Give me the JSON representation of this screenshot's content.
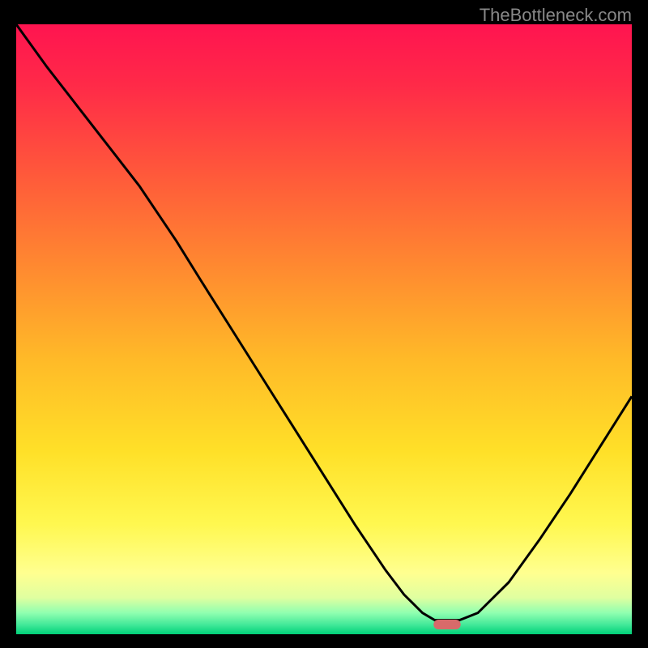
{
  "watermark": "TheBottleneck.com",
  "chart_data": {
    "type": "line",
    "title": "",
    "xlabel": "",
    "ylabel": "",
    "xlim": [
      0,
      100
    ],
    "ylim": [
      0,
      100
    ],
    "background_gradient": {
      "stops": [
        {
          "offset": 0.0,
          "color": "#ff1450"
        },
        {
          "offset": 0.1,
          "color": "#ff2a48"
        },
        {
          "offset": 0.25,
          "color": "#ff5a3a"
        },
        {
          "offset": 0.4,
          "color": "#ff8a30"
        },
        {
          "offset": 0.55,
          "color": "#ffba28"
        },
        {
          "offset": 0.7,
          "color": "#ffe028"
        },
        {
          "offset": 0.82,
          "color": "#fff850"
        },
        {
          "offset": 0.9,
          "color": "#ffff90"
        },
        {
          "offset": 0.94,
          "color": "#e0ffa0"
        },
        {
          "offset": 0.965,
          "color": "#90ffb0"
        },
        {
          "offset": 0.985,
          "color": "#40e898"
        },
        {
          "offset": 1.0,
          "color": "#00d078"
        }
      ]
    },
    "series": [
      {
        "name": "bottleneck-curve",
        "color": "#000000",
        "width": 3,
        "x": [
          0.0,
          5.0,
          10.0,
          15.0,
          20.0,
          23.0,
          26.0,
          30.0,
          35.0,
          40.0,
          45.0,
          50.0,
          55.0,
          60.0,
          63.0,
          66.0,
          68.0,
          72.0,
          75.0,
          80.0,
          85.0,
          90.0,
          95.0,
          100.0
        ],
        "y": [
          100.0,
          93.0,
          86.5,
          80.0,
          73.5,
          69.0,
          64.5,
          58.0,
          50.0,
          42.0,
          34.0,
          26.0,
          18.0,
          10.5,
          6.5,
          3.5,
          2.3,
          2.3,
          3.5,
          8.5,
          15.5,
          23.0,
          31.0,
          39.0
        ]
      }
    ],
    "marker": {
      "name": "optimal-zone-marker",
      "color": "#d86a6a",
      "x_center": 70.0,
      "x_half_width": 2.2,
      "y": 1.6
    }
  }
}
